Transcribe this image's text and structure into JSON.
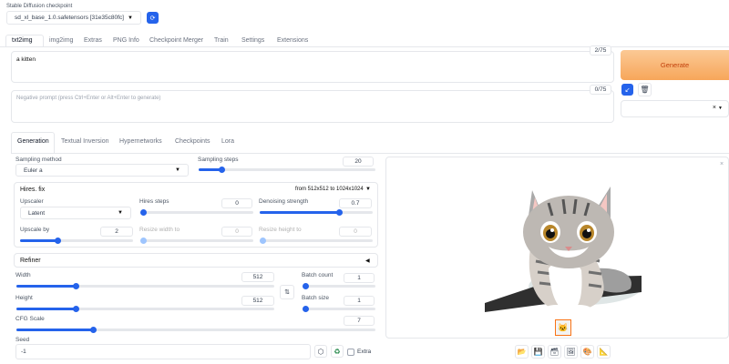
{
  "checkpoint": {
    "label": "Stable Diffusion checkpoint",
    "value": "sd_xl_base_1.0.safetensors [31e35c80fc]"
  },
  "main_tabs": [
    "txt2img",
    "img2img",
    "Extras",
    "PNG Info",
    "Checkpoint Merger",
    "Train",
    "Settings",
    "Extensions"
  ],
  "prompt": {
    "value": "a kitten",
    "counter": "2/75"
  },
  "negative_prompt": {
    "placeholder": "Negative prompt (press Ctrl+Enter or Alt+Enter to generate)",
    "counter": "0/75"
  },
  "generate_label": "Generate",
  "sub_tabs": [
    "Generation",
    "Textual Inversion",
    "Hypernetworks",
    "Checkpoints",
    "Lora"
  ],
  "sampling": {
    "method_label": "Sampling method",
    "method_value": "Euler a",
    "steps_label": "Sampling steps",
    "steps_value": "20",
    "steps_fraction": 0.13
  },
  "hires": {
    "title": "Hires. fix",
    "from_to": "from 512x512  to 1024x1024",
    "upscaler_label": "Upscaler",
    "upscaler_value": "Latent",
    "hires_steps_label": "Hires steps",
    "hires_steps_value": "0",
    "denoise_label": "Denoising strength",
    "denoise_value": "0.7",
    "upscale_label": "Upscale by",
    "upscale_value": "2",
    "resize_w_label": "Resize width to",
    "resize_w_value": "0",
    "resize_h_label": "Resize height to",
    "resize_h_value": "0"
  },
  "refiner": {
    "title": "Refiner"
  },
  "size": {
    "width_label": "Width",
    "width_value": "512",
    "height_label": "Height",
    "height_value": "512",
    "batch_count_label": "Batch count",
    "batch_count_value": "1",
    "batch_size_label": "Batch size",
    "batch_size_value": "1"
  },
  "cfg": {
    "label": "CFG Scale",
    "value": "7"
  },
  "seed": {
    "label": "Seed",
    "value": "-1",
    "extra_label": "Extra"
  },
  "close_symbol": "×",
  "colors": {
    "accent": "#2563eb",
    "generate_bg": "#f8b36b",
    "generate_text": "#c2410c"
  }
}
